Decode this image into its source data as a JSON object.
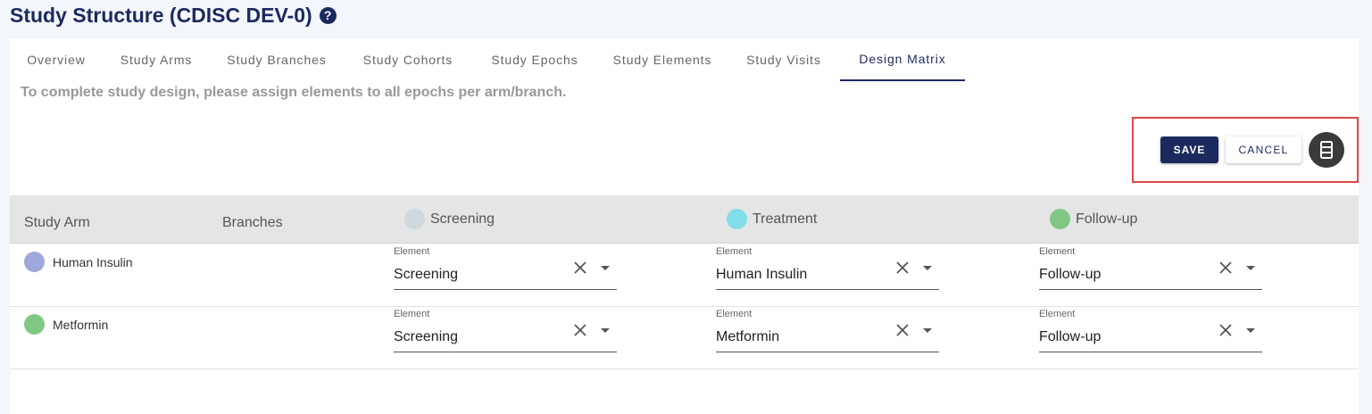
{
  "page": {
    "title": "Study Structure (CDISC DEV-0)",
    "help_icon": "?"
  },
  "tabs": [
    {
      "label": "Overview"
    },
    {
      "label": "Study Arms"
    },
    {
      "label": "Study Branches"
    },
    {
      "label": "Study Cohorts"
    },
    {
      "label": "Study Epochs"
    },
    {
      "label": "Study Elements"
    },
    {
      "label": "Study Visits"
    },
    {
      "label": "Design Matrix",
      "active": true
    }
  ],
  "note": "To complete study design, please assign elements to all epochs per arm/branch.",
  "actions": {
    "save": "SAVE",
    "cancel": "CANCEL",
    "columns_icon": "column-layout-icon"
  },
  "table": {
    "headers": {
      "arm": "Study Arm",
      "branches": "Branches"
    },
    "epochs": [
      {
        "name": "Screening",
        "color": "#cfd8dc"
      },
      {
        "name": "Treatment",
        "color": "#80deea"
      },
      {
        "name": "Follow-up",
        "color": "#81c784"
      }
    ],
    "rows": [
      {
        "arm": "Human Insulin",
        "color": "#9fa8da",
        "cells": [
          {
            "label": "Element",
            "value": "Screening"
          },
          {
            "label": "Element",
            "value": "Human Insulin"
          },
          {
            "label": "Element",
            "value": "Follow-up"
          }
        ]
      },
      {
        "arm": "Metformin",
        "color": "#81c784",
        "cells": [
          {
            "label": "Element",
            "value": "Screening"
          },
          {
            "label": "Element",
            "value": "Metformin"
          },
          {
            "label": "Element",
            "value": "Follow-up"
          }
        ]
      }
    ]
  }
}
